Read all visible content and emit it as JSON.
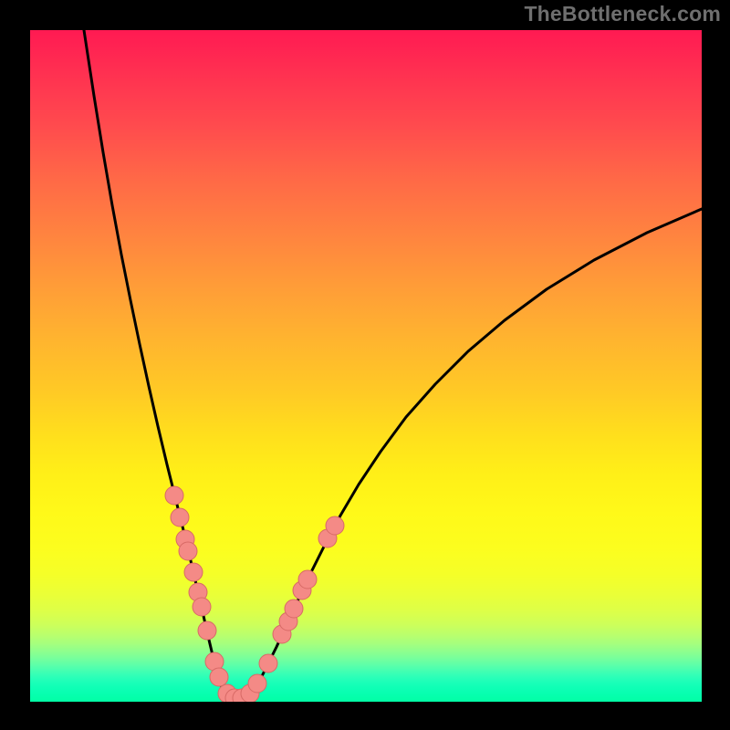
{
  "watermark": "TheBottleneck.com",
  "colors": {
    "frame": "#000000",
    "curve": "#000000",
    "dot_fill": "#f48a86",
    "dot_stroke": "#d86a66"
  },
  "chart_data": {
    "type": "line",
    "title": "",
    "xlabel": "",
    "ylabel": "",
    "xlim": [
      0,
      736
    ],
    "ylim_display_note": "y plotted downward; 0 = top of plot, 736 = bottom",
    "series": [
      {
        "name": "left-branch",
        "x": [
          59,
          70,
          80,
          90,
          100,
          110,
          120,
          130,
          140,
          150,
          160,
          170,
          178,
          184,
          190,
          195,
          200,
          205,
          210
        ],
        "y": [
          0,
          72,
          134,
          192,
          246,
          296,
          344,
          390,
          434,
          476,
          516,
          556,
          590,
          616,
          642,
          664,
          685,
          704,
          720
        ]
      },
      {
        "name": "valley-floor",
        "x": [
          210,
          214,
          218,
          222,
          226,
          230,
          234,
          238,
          242
        ],
        "y": [
          720,
          726,
          730,
          732,
          733,
          733,
          732,
          730,
          727
        ]
      },
      {
        "name": "right-branch",
        "x": [
          242,
          248,
          255,
          262,
          270,
          280,
          292,
          306,
          322,
          340,
          360,
          384,
          412,
          444,
          480,
          520,
          566,
          618,
          676,
          736
        ],
        "y": [
          727,
          718,
          706,
          692,
          676,
          654,
          628,
          598,
          566,
          532,
          498,
          462,
          424,
          388,
          352,
          318,
          284,
          252,
          222,
          196
        ]
      }
    ],
    "dots": [
      {
        "x": 158,
        "y": 510
      },
      {
        "x": 164,
        "y": 534
      },
      {
        "x": 170,
        "y": 558
      },
      {
        "x": 173,
        "y": 571
      },
      {
        "x": 179,
        "y": 594
      },
      {
        "x": 184,
        "y": 616
      },
      {
        "x": 188,
        "y": 632
      },
      {
        "x": 194,
        "y": 658
      },
      {
        "x": 202,
        "y": 692
      },
      {
        "x": 207,
        "y": 709
      },
      {
        "x": 216,
        "y": 727
      },
      {
        "x": 224,
        "y": 732
      },
      {
        "x": 232,
        "y": 732
      },
      {
        "x": 241,
        "y": 727
      },
      {
        "x": 249,
        "y": 716
      },
      {
        "x": 261,
        "y": 694
      },
      {
        "x": 276,
        "y": 662
      },
      {
        "x": 283,
        "y": 648
      },
      {
        "x": 289,
        "y": 634
      },
      {
        "x": 298,
        "y": 614
      },
      {
        "x": 304,
        "y": 602
      },
      {
        "x": 326,
        "y": 557
      },
      {
        "x": 334,
        "y": 543
      }
    ],
    "dot_radius": 10
  }
}
